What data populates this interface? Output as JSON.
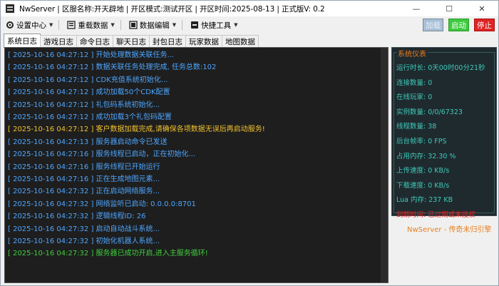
{
  "window": {
    "title": "NwServer  |  区服名称:开天辟地  |  开区模式:测试开区  |  开区时间:2025-08-13 |  正式版V: 0.2",
    "controls": {
      "minimize": "—",
      "maximize": "☐",
      "close": "✕"
    }
  },
  "toolbar": {
    "items": [
      {
        "label": "设置中心"
      },
      {
        "label": "重载数据"
      },
      {
        "label": "数据编辑"
      },
      {
        "label": "快捷工具"
      }
    ]
  },
  "controls": {
    "load": "加载",
    "start": "启动",
    "stop": "停止"
  },
  "tabs": [
    {
      "label": "系统日志",
      "active": true
    },
    {
      "label": "游戏日志"
    },
    {
      "label": "命令日志"
    },
    {
      "label": "聊天日志"
    },
    {
      "label": "封包日志"
    },
    {
      "label": "玩家数据"
    },
    {
      "label": "地图数据"
    }
  ],
  "log": [
    {
      "text": "[ 2025-10-16 04:27:12 ] 开始处理数据关联任务...",
      "color": "#4da6ff"
    },
    {
      "text": "[ 2025-10-16 04:27:12 ] 数据关联任务处理完成, 任务总数:102",
      "color": "#4da6ff"
    },
    {
      "text": "[ 2025-10-16 04:27:12 ] CDK充值系统初始化...",
      "color": "#4da6ff"
    },
    {
      "text": "[ 2025-10-16 04:27:12 ] 成功加载50个CDK配置",
      "color": "#4da6ff"
    },
    {
      "text": "[ 2025-10-16 04:27:12 ] 礼包码系统初始化...",
      "color": "#4da6ff"
    },
    {
      "text": "[ 2025-10-16 04:27:12 ] 成功加载3个礼包码配置",
      "color": "#4da6ff"
    },
    {
      "text": "[ 2025-10-16 04:27:12 ] 客户数据加载完成,请确保各项数据无误后再启动服务!",
      "color": "#f2c12e"
    },
    {
      "text": "[ 2025-10-16 04:27:13 ] 服务器启动命令已发送",
      "color": "#4da6ff"
    },
    {
      "text": "[ 2025-10-16 04:27:16 ] 服务线程已启动，正在初始化...",
      "color": "#4da6ff"
    },
    {
      "text": "[ 2025-10-16 04:27:16 ] 服务线程已开始运行",
      "color": "#4da6ff"
    },
    {
      "text": "[ 2025-10-16 04:27:16 ] 正在生成地图元素...",
      "color": "#4da6ff"
    },
    {
      "text": "[ 2025-10-16 04:27:32 ] 正在启动网络服务...",
      "color": "#4da6ff"
    },
    {
      "text": "[ 2025-10-16 04:27:32 ] 网络监听已启动: 0.0.0.0:8701",
      "color": "#4da6ff"
    },
    {
      "text": "[ 2025-10-16 04:27:32 ] 逻辑线程ID: 26",
      "color": "#4da6ff"
    },
    {
      "text": "[ 2025-10-16 04:27:32 ] 启动自动战斗系统...",
      "color": "#4da6ff"
    },
    {
      "text": "[ 2025-10-16 04:27:32 ] 初始化机器人系统...",
      "color": "#4da6ff"
    },
    {
      "text": "[ 2025-10-16 04:27:32 ] 服务器已成功开启,进入主服务循环!",
      "color": "#3ecf3e"
    }
  ],
  "monitor": {
    "title": "系统仪表",
    "rows": [
      {
        "text": "运行时长: 0天00时00分21秒"
      },
      {
        "text": "连接数量: 0"
      },
      {
        "text": "在线玩家: 0"
      },
      {
        "text": "实例数量: 0/0/67323"
      },
      {
        "text": "线程数量: 38"
      },
      {
        "text": "后台帧率: 0 FPS"
      },
      {
        "text": "占用内存: 32.30 %"
      },
      {
        "text": "上传速度: 0 KB/s"
      },
      {
        "text": "下载速度: 0 KB/s"
      },
      {
        "text": "Lua 内存: 237 KB"
      },
      {
        "text": "到期时间: 已过期或未授权",
        "red": true
      }
    ]
  },
  "brand": {
    "text": "NwServer - 传奇未归引擎"
  }
}
